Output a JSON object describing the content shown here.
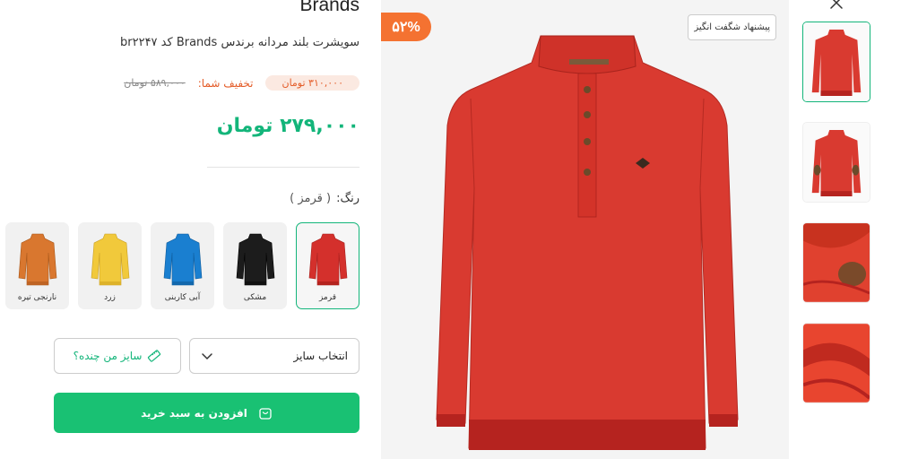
{
  "product": {
    "brand": "Brands",
    "title": "سویشرت بلند مردانه برندس Brands کد br۲۲۴۷",
    "old_price": "۵۸۹,۰۰۰ تومان",
    "discount_label": "تخفیف شما:",
    "discount_amount": "۳۱۰,۰۰۰ تومان",
    "price": "۲۷۹,۰۰۰ تومان",
    "discount_percent": "۵۲%",
    "amazing_offer": "پیشنهاد شگفت انگیز"
  },
  "colors": {
    "label": "رنگ:",
    "selected": "( قرمز )",
    "options": [
      {
        "label": "قرمز",
        "hex": "#d4302c"
      },
      {
        "label": "مشکی",
        "hex": "#1c1c1c"
      },
      {
        "label": "آبی کاربنی",
        "hex": "#1a7fd0"
      },
      {
        "label": "زرد",
        "hex": "#f1c93b"
      },
      {
        "label": "نارنجی تیره",
        "hex": "#d9772f"
      }
    ]
  },
  "size": {
    "select_label": "انتخاب سایز",
    "guide_label": "سایز من چنده؟"
  },
  "cart": {
    "add_label": "افزودن به سبد خرید"
  },
  "theme": {
    "accent": "#19c173",
    "discount": "#f47231",
    "shirt": "#d93a30"
  }
}
